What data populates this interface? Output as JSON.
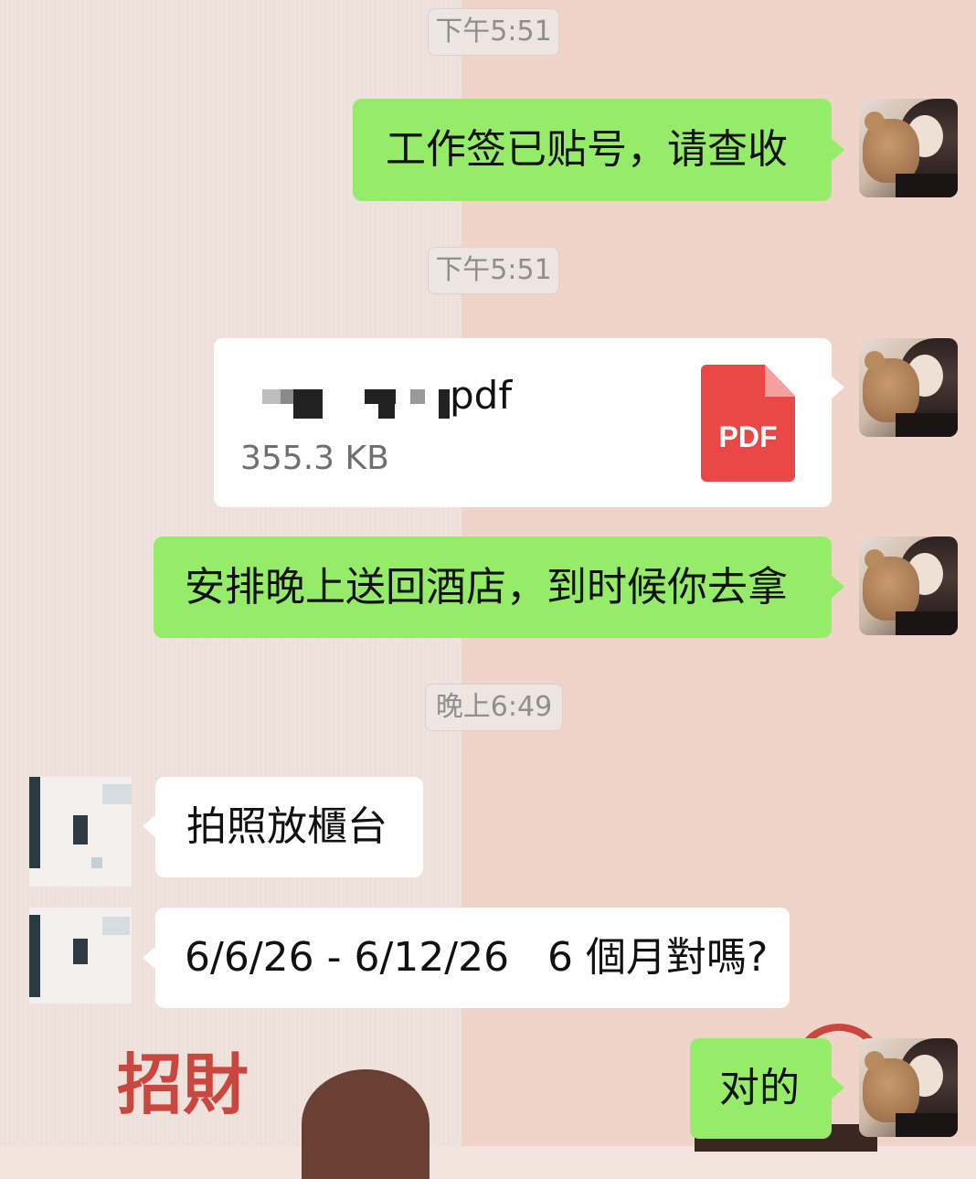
{
  "messages": [
    {
      "type": "time",
      "text": "下午5:51"
    },
    {
      "type": "sent_text",
      "text": "工作签已贴号，请查收"
    },
    {
      "type": "time",
      "text": "下午5:51"
    },
    {
      "type": "sent_file",
      "file_ext": "pdf",
      "size": "355.3 KB",
      "icon_label": "PDF"
    },
    {
      "type": "sent_text",
      "text": "安排晚上送回酒店，到时候你去拿"
    },
    {
      "type": "time",
      "text": "晚上6:49"
    },
    {
      "type": "received_text",
      "text": "拍照放櫃台"
    },
    {
      "type": "received_text",
      "text": "6/6/26 - 6/12/26   6 個月對嗎?"
    },
    {
      "type": "sent_text",
      "text": "对的"
    }
  ],
  "sticker": {
    "text": "招財"
  },
  "colors": {
    "sent_bubble": "#95ec69",
    "received_bubble": "#ffffff",
    "pdf_icon": "#e94846",
    "time_text": "#8e8e8e"
  },
  "icons": {
    "pdf": "pdf-file-icon",
    "sender_avatar": "girl-with-teddy-bear-avatar",
    "receiver_avatar": "pixelated-avatar"
  }
}
